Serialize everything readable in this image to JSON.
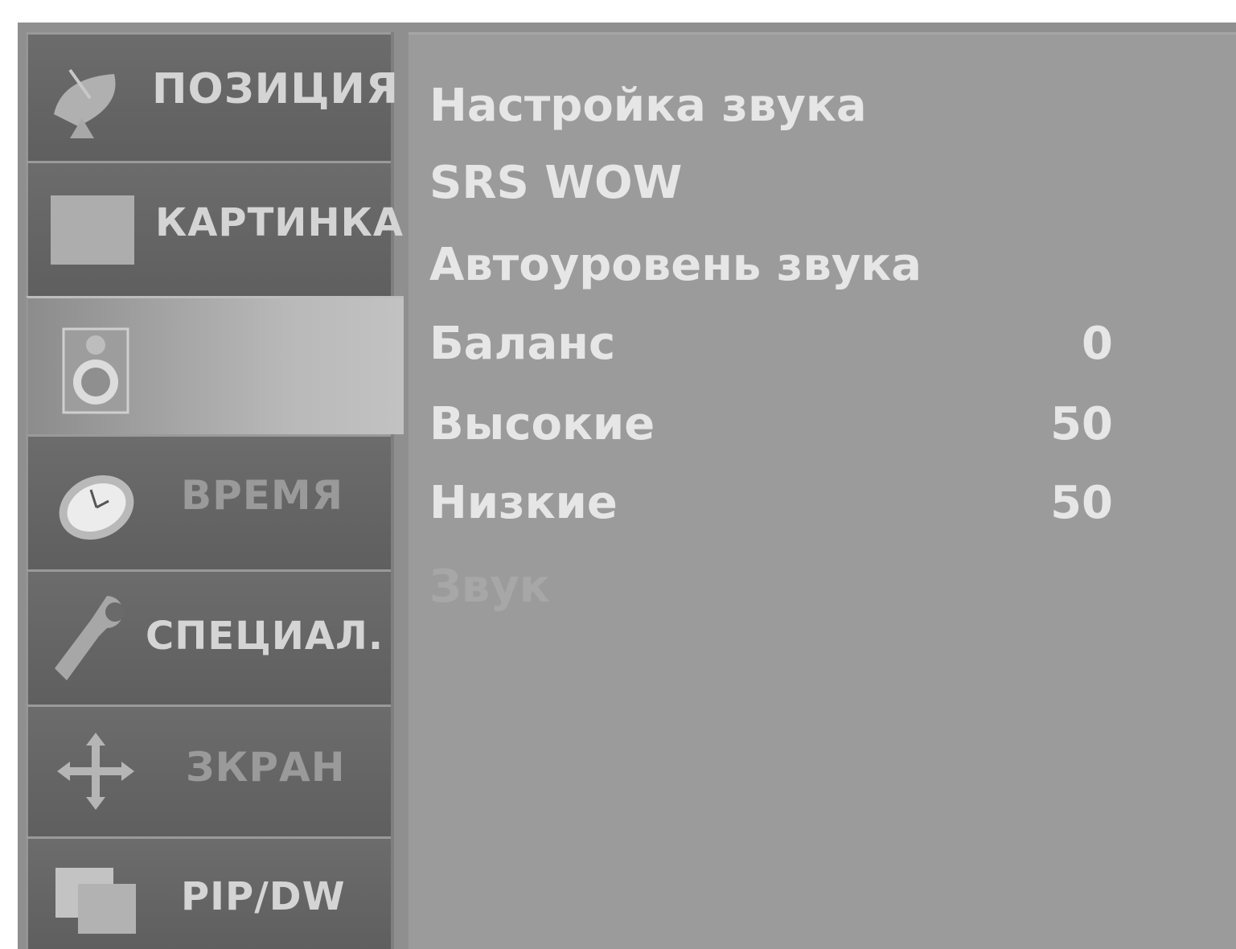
{
  "sidebar": {
    "items": [
      {
        "label": "ПОЗИЦИЯ",
        "icon": "satellite-dish-icon"
      },
      {
        "label": "КАРТИНКА",
        "icon": "picture-square-icon"
      },
      {
        "label": "",
        "icon": "speaker-icon",
        "selected": true
      },
      {
        "label": "ВРЕМЯ",
        "icon": "clock-icon"
      },
      {
        "label": "СПЕЦИАЛ.",
        "icon": "tag-icon"
      },
      {
        "label": "ЗКРАН",
        "icon": "move-arrows-icon"
      },
      {
        "label": "PIP/DW",
        "icon": "pip-windows-icon"
      }
    ]
  },
  "menu": {
    "items": [
      {
        "label": "Настройка звука",
        "value": ""
      },
      {
        "label": "SRS WOW",
        "value": ""
      },
      {
        "label": "Автоуровень звука",
        "value": ""
      },
      {
        "label": "Баланс",
        "value": "0"
      },
      {
        "label": "Высокие",
        "value": "50"
      },
      {
        "label": "Низкие",
        "value": "50"
      },
      {
        "label": "Звук",
        "value": ""
      }
    ]
  },
  "colors": {
    "panel": "#8f8f8f",
    "tab": "#666666",
    "selected_tab": "#b5b5b5",
    "text": "#e6e6e6"
  }
}
